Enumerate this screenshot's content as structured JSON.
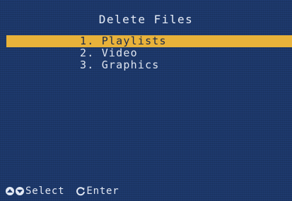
{
  "screen": {
    "title": "Delete Files"
  },
  "menu": {
    "items": [
      {
        "label": "1. Playlists",
        "selected": true
      },
      {
        "label": "2. Video",
        "selected": false
      },
      {
        "label": "3. Graphics",
        "selected": false
      }
    ]
  },
  "footer": {
    "select_label": "Select",
    "enter_label": "Enter"
  },
  "colors": {
    "background": "#1e3a6e",
    "highlight": "#e8b23a",
    "text": "#e0e6f0"
  },
  "icons": {
    "up": "up-arrow-icon",
    "down": "down-arrow-icon",
    "enter": "rotate-enter-icon"
  }
}
